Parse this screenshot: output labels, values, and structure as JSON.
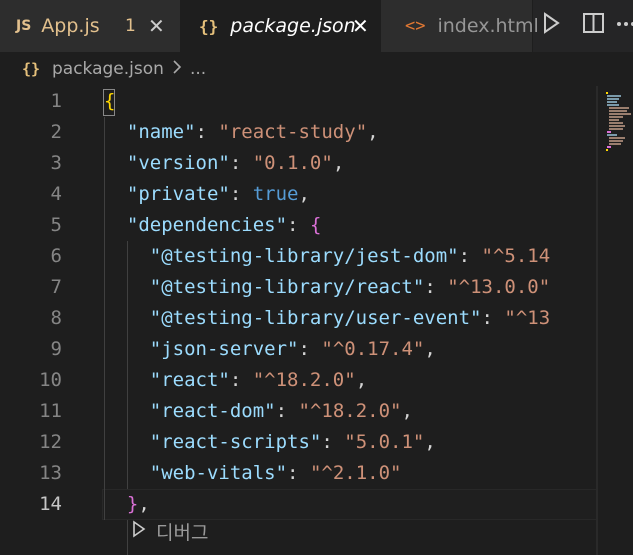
{
  "tabs": [
    {
      "badge": "JS",
      "label": "App.js",
      "count": "1"
    },
    {
      "label": "package.json"
    },
    {
      "label": "index.html"
    }
  ],
  "breadcrumb": {
    "file": "package.json",
    "more": "..."
  },
  "line_numbers": [
    "1",
    "2",
    "3",
    "4",
    "5",
    "6",
    "7",
    "8",
    "9",
    "10",
    "11",
    "12",
    "13",
    "14"
  ],
  "codelens": {
    "label": "디버그"
  },
  "code": {
    "name_key": "\"name\"",
    "name_val": "\"react-study\"",
    "version_key": "\"version\"",
    "version_val": "\"0.1.0\"",
    "private_key": "\"private\"",
    "private_val": "true",
    "deps_key": "\"dependencies\"",
    "dep1_key": "\"@testing-library/jest-dom\"",
    "dep1_val": "\"^5.14",
    "dep2_key": "\"@testing-library/react\"",
    "dep2_val": "\"^13.0.0\"",
    "dep3_key": "\"@testing-library/user-event\"",
    "dep3_val": "\"^13",
    "dep4_key": "\"json-server\"",
    "dep4_val": "\"^0.17.4\"",
    "dep5_key": "\"react\"",
    "dep5_val": "\"^18.2.0\"",
    "dep6_key": "\"react-dom\"",
    "dep6_val": "\"^18.2.0\"",
    "dep7_key": "\"react-scripts\"",
    "dep7_val": "\"5.0.1\"",
    "dep8_key": "\"web-vitals\"",
    "dep8_val": "\"^2.1.0\""
  }
}
